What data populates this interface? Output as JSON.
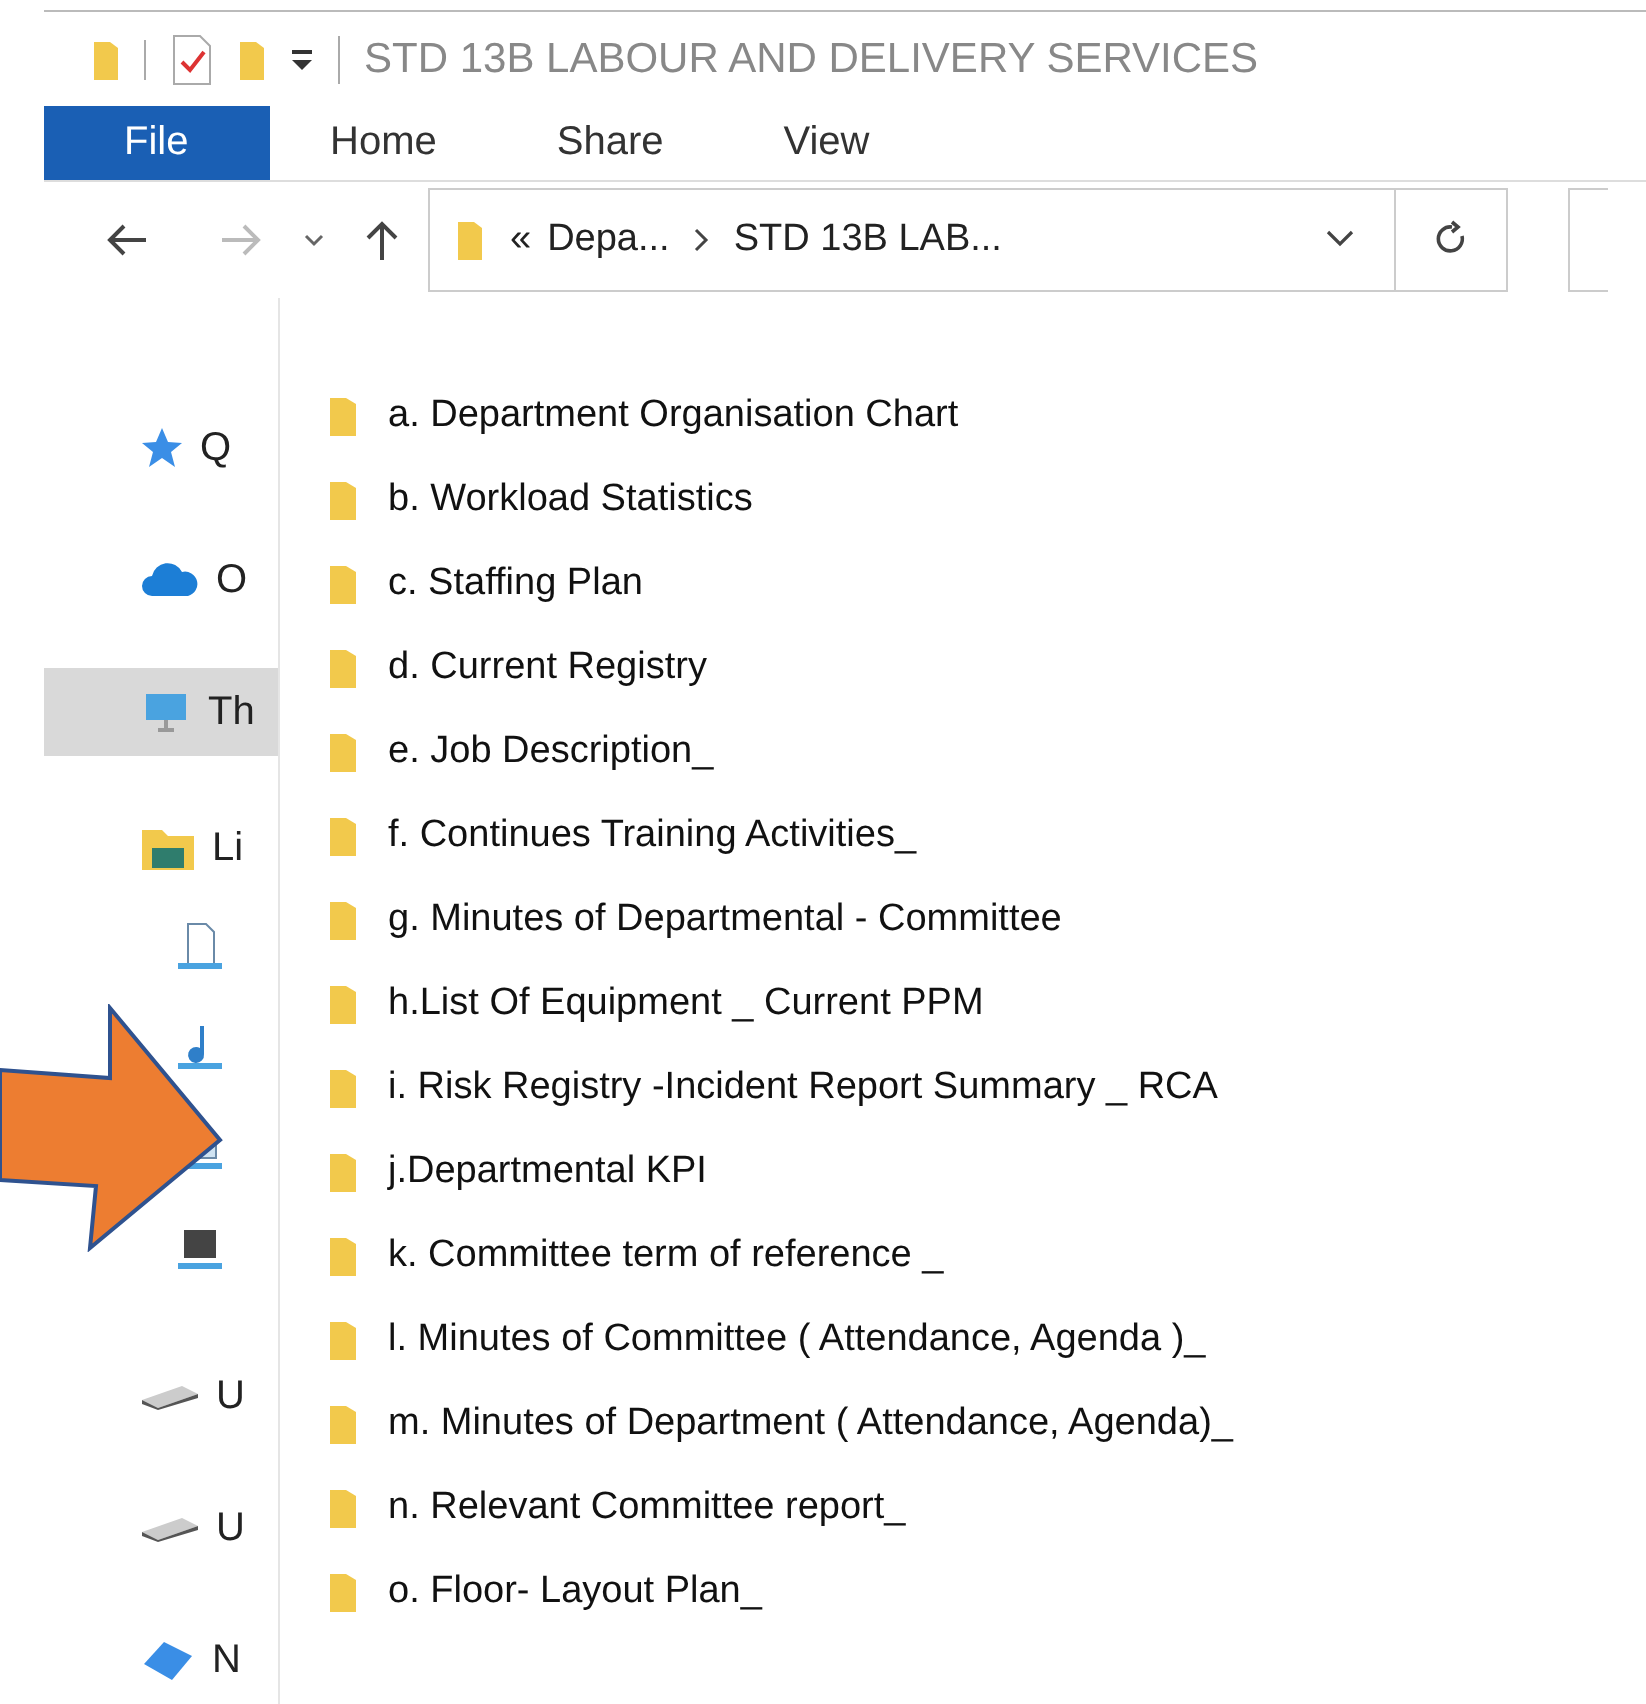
{
  "window": {
    "title": "STD 13B LABOUR AND DELIVERY SERVICES"
  },
  "ribbon_tabs": [
    {
      "label": "File",
      "selected": true
    },
    {
      "label": "Home",
      "selected": false
    },
    {
      "label": "Share",
      "selected": false
    },
    {
      "label": "View",
      "selected": false
    }
  ],
  "address_bar": {
    "overflow": "«",
    "breadcrumbs": [
      "Depa...",
      "STD 13B LAB..."
    ]
  },
  "sidebar": {
    "items": [
      {
        "kind": "star",
        "label": "Q",
        "selected": false
      },
      {
        "kind": "cloud",
        "label": "O",
        "selected": false
      },
      {
        "kind": "pc",
        "label": "Th",
        "selected": true
      },
      {
        "kind": "library",
        "label": "Li",
        "selected": false
      },
      {
        "kind": "document",
        "selected": false
      },
      {
        "kind": "music",
        "selected": false
      },
      {
        "kind": "picture",
        "selected": false
      },
      {
        "kind": "video",
        "selected": false
      },
      {
        "kind": "drive",
        "label": "U",
        "selected": false
      },
      {
        "kind": "drive",
        "label": "U",
        "selected": false
      },
      {
        "kind": "network",
        "label": "N",
        "selected": false
      }
    ]
  },
  "folders": [
    "a. Department Organisation Chart",
    "b. Workload Statistics",
    "c. Staffing Plan",
    "d. Current Registry",
    "e. Job Description_",
    "f. Continues Training Activities_",
    "g. Minutes of Departmental - Committee",
    "h.List Of Equipment _ Current PPM",
    "i. Risk Registry -Incident Report Summary _ RCA",
    "j.Departmental KPI",
    "k. Committee term of reference _",
    "l. Minutes of Committee ( Attendance, Agenda )_",
    "m. Minutes of Department ( Attendance, Agenda)_",
    "n. Relevant Committee report_",
    "o. Floor- Layout Plan_"
  ]
}
